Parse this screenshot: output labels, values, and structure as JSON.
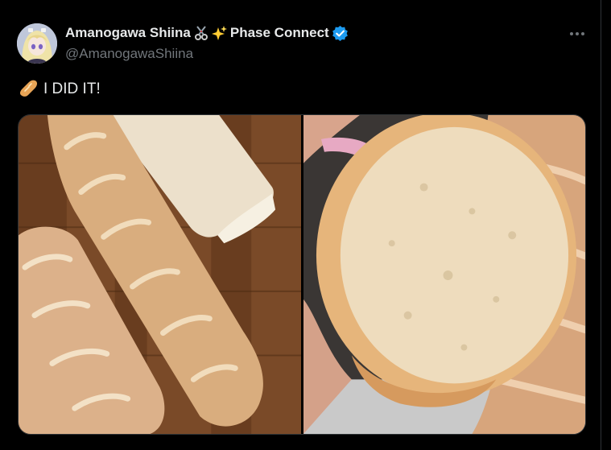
{
  "tweet": {
    "display_name": "Amanogawa Shiina",
    "name_emojis": [
      "scissors-emoji",
      "sparkles-emoji"
    ],
    "name_suffix": "Phase Connect",
    "verified": true,
    "handle": "@AmanogawaShiina",
    "text": "I DID IT!",
    "text_emoji": "baguette-emoji",
    "media_count": 2
  },
  "colors": {
    "background": "#000000",
    "text_primary": "#e7e9ea",
    "text_secondary": "#71767b",
    "verified_blue": "#1d9bf0",
    "border": "#2f3336"
  },
  "icons": {
    "more": "more-horizontal-icon",
    "verified": "verified-badge-icon"
  }
}
